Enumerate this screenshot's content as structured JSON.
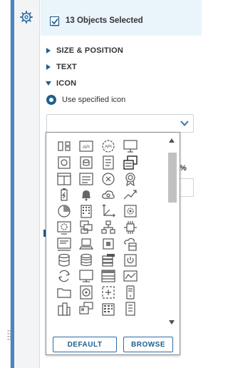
{
  "header": {
    "title": "13 Objects Selected"
  },
  "sections": [
    {
      "label": "SIZE & POSITION",
      "state": "collapsed"
    },
    {
      "label": "TEXT",
      "state": "collapsed"
    },
    {
      "label": "ICON",
      "state": "expanded"
    }
  ],
  "icon_settings": {
    "mode_label": "Use specified icon",
    "dropdown_value": ""
  },
  "background_field": {
    "unit": "%"
  },
  "icon_picker": {
    "icons": [
      "node-icon",
      "api-icon",
      "api-gear-icon",
      "monitor-icon",
      "server-box-icon",
      "database-box-icon",
      "document-icon",
      "dashboard-stack-icon",
      "table-icon",
      "list-icon",
      "alert-circle-icon",
      "badge-icon",
      "battery-icon",
      "bell-icon",
      "cloud-icon",
      "trend-chart-icon",
      "pie-chart-icon",
      "building-icon",
      "axis-icon",
      "settings-gear-icon",
      "gear-box-icon",
      "stack-icon",
      "network-icon",
      "chip-icon",
      "terminal-icon",
      "laptop-icon",
      "processor-icon",
      "cloud-db-icon",
      "database-icon",
      "database-stack-icon",
      "storage-icon",
      "power-icon",
      "refresh-icon",
      "screen-icon",
      "rack-icon",
      "chart-box-icon",
      "folder-icon",
      "disk-icon",
      "placeholder-icon",
      "phone-icon",
      "servers-icon",
      "group-icon",
      "building-2-icon",
      "report-icon"
    ],
    "default_label": "DEFAULT",
    "browse_label": "BROWSE"
  }
}
